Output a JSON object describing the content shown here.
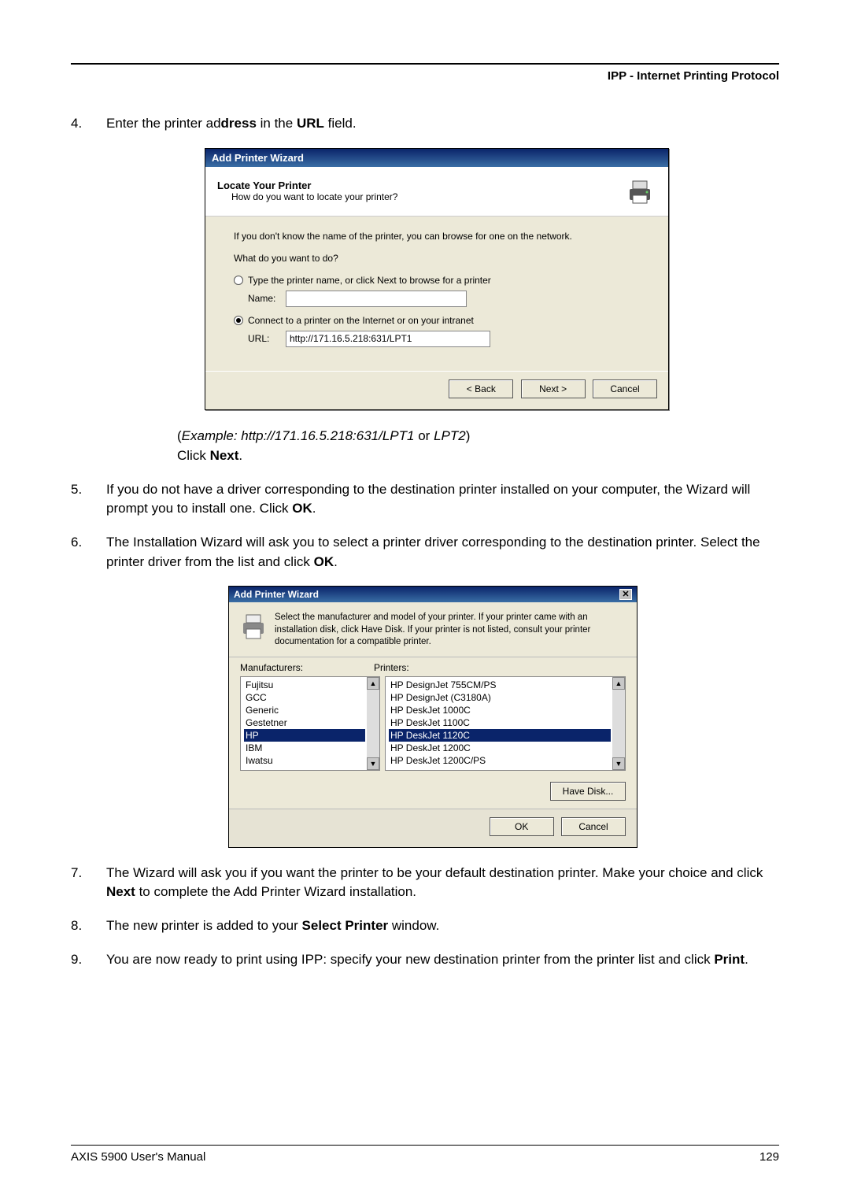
{
  "header": {
    "title": "IPP - Internet Printing Protocol"
  },
  "step4": {
    "num": "4.",
    "text_a": "Enter the printer ad",
    "text_b": "dress",
    "text_c": " in the ",
    "text_d": "URL",
    "text_e": " field."
  },
  "dlg1": {
    "title": "Add Printer Wizard",
    "sub_title": "Locate Your Printer",
    "sub_sub": "How do you want to locate your printer?",
    "line1": "If you don't know the name of the printer, you can browse for one on the network.",
    "line2": "What do you want to do?",
    "radio1": "Type the printer name, or click Next to browse for a printer",
    "name_label": "Name:",
    "radio2": "Connect to a printer on the Internet or on your intranet",
    "url_label": "URL:",
    "url_value": "http://171.16.5.218:631/LPT1",
    "back": "< Back",
    "next": "Next >",
    "cancel": "Cancel"
  },
  "example": {
    "open": "(",
    "ex": "Example: http://171.16.5.218:631/LPT1",
    "or": " or ",
    "lpt2": "LPT2",
    "close": ")",
    "click_a": "Click ",
    "click_b": "Next",
    "click_c": "."
  },
  "step5": {
    "num": "5.",
    "text_a": "If you do not have a driver corresponding to the destination printer installed on your computer, the Wizard will prompt you to install one. Click ",
    "text_b": "OK",
    "text_c": "."
  },
  "step6": {
    "num": "6.",
    "text_a": "The Installation Wizard will ask you to select a printer driver corresponding to the destination printer. Select the printer driver from the list and click ",
    "text_b": "OK",
    "text_c": "."
  },
  "dlg2": {
    "title": "Add Printer Wizard",
    "desc": "Select the manufacturer and model of your printer. If your printer came with an installation disk, click Have Disk. If your printer is not listed, consult your printer documentation for a compatible printer.",
    "label_mfr": "Manufacturers:",
    "label_prn": "Printers:",
    "mfrs": [
      "Fujitsu",
      "GCC",
      "Generic",
      "Gestetner",
      "HP",
      "IBM",
      "Iwatsu"
    ],
    "mfr_selected": "HP",
    "printers": [
      "HP DesignJet 755CM/PS",
      "HP DesignJet (C3180A)",
      "HP DeskJet 1000C",
      "HP DeskJet 1100C",
      "HP DeskJet 1120C",
      "HP DeskJet 1200C",
      "HP DeskJet 1200C/PS"
    ],
    "printer_selected": "HP DeskJet 1120C",
    "have_disk": "Have Disk...",
    "ok": "OK",
    "cancel": "Cancel"
  },
  "step7": {
    "num": "7.",
    "text_a": "The Wizard will ask you if you want the printer to be your default destination printer. Make your choice and click ",
    "text_b": "Next",
    "text_c": " to complete the Add Printer Wizard installation."
  },
  "step8": {
    "num": "8.",
    "text_a": "The new printer is added to your ",
    "text_b": "Select Printer",
    "text_c": " window."
  },
  "step9": {
    "num": "9.",
    "text_a": "You are now ready to print using IPP: specify your new destination printer from the printer list and click ",
    "text_b": "Print",
    "text_c": "."
  },
  "footer": {
    "left": "AXIS 5900 User's Manual",
    "right": "129"
  }
}
